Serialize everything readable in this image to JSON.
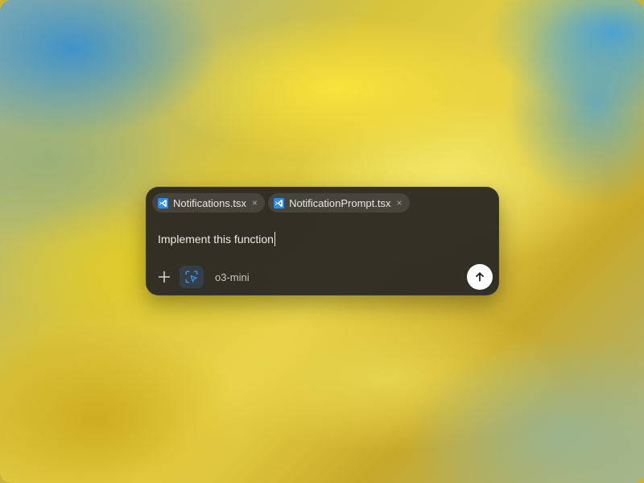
{
  "attachments": [
    {
      "label": "Notifications.tsx",
      "icon": "vscode-icon",
      "close": "×"
    },
    {
      "label": "NotificationPrompt.tsx",
      "icon": "vscode-icon",
      "close": "×"
    }
  ],
  "prompt": {
    "text": "Implement this function"
  },
  "toolbar": {
    "add_icon": "plus-icon",
    "select_icon": "select-area-icon",
    "model": "o3-mini",
    "send_icon": "arrow-up-icon"
  },
  "colors": {
    "panel": "#2c2a24",
    "text": "#ecebe7",
    "accent": "#3b8fe0",
    "send_bg": "#ffffff"
  }
}
